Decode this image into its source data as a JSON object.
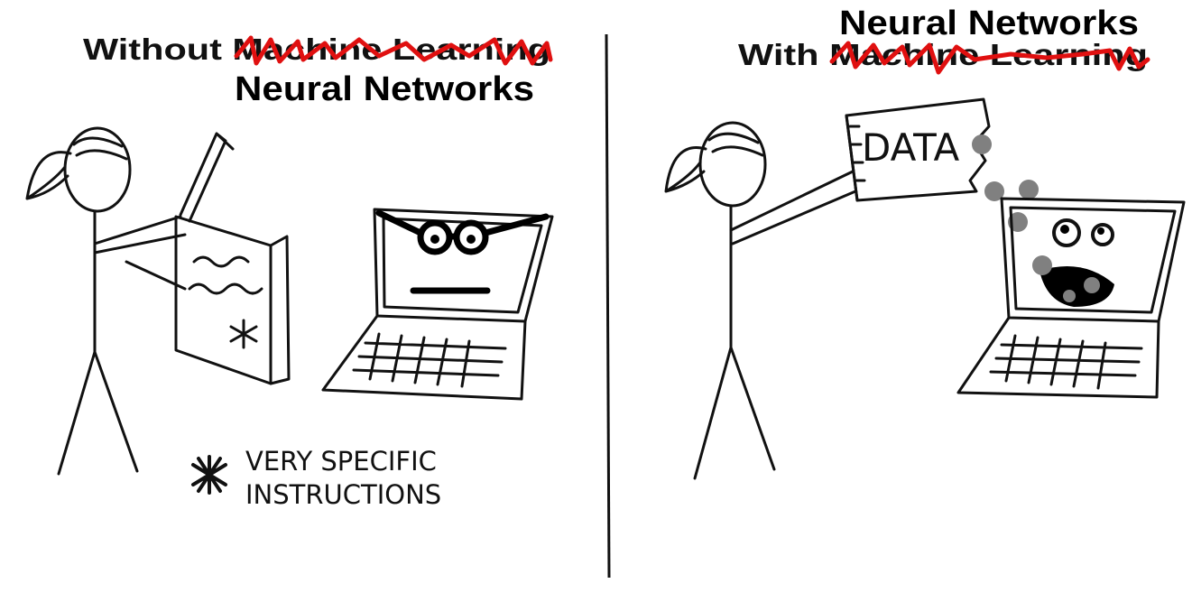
{
  "left_panel": {
    "title": "Without Machine Learning",
    "replacement": "Neural Networks",
    "footnote_line1": "VERY SPECIFIC",
    "footnote_line2": "INSTRUCTIONS"
  },
  "right_panel": {
    "title": "With Machine Learning",
    "replacement": "Neural Networks",
    "bag_label": "DATA"
  },
  "colors": {
    "ink": "#111111",
    "strike": "#e01010",
    "data_dots": "#808080"
  }
}
